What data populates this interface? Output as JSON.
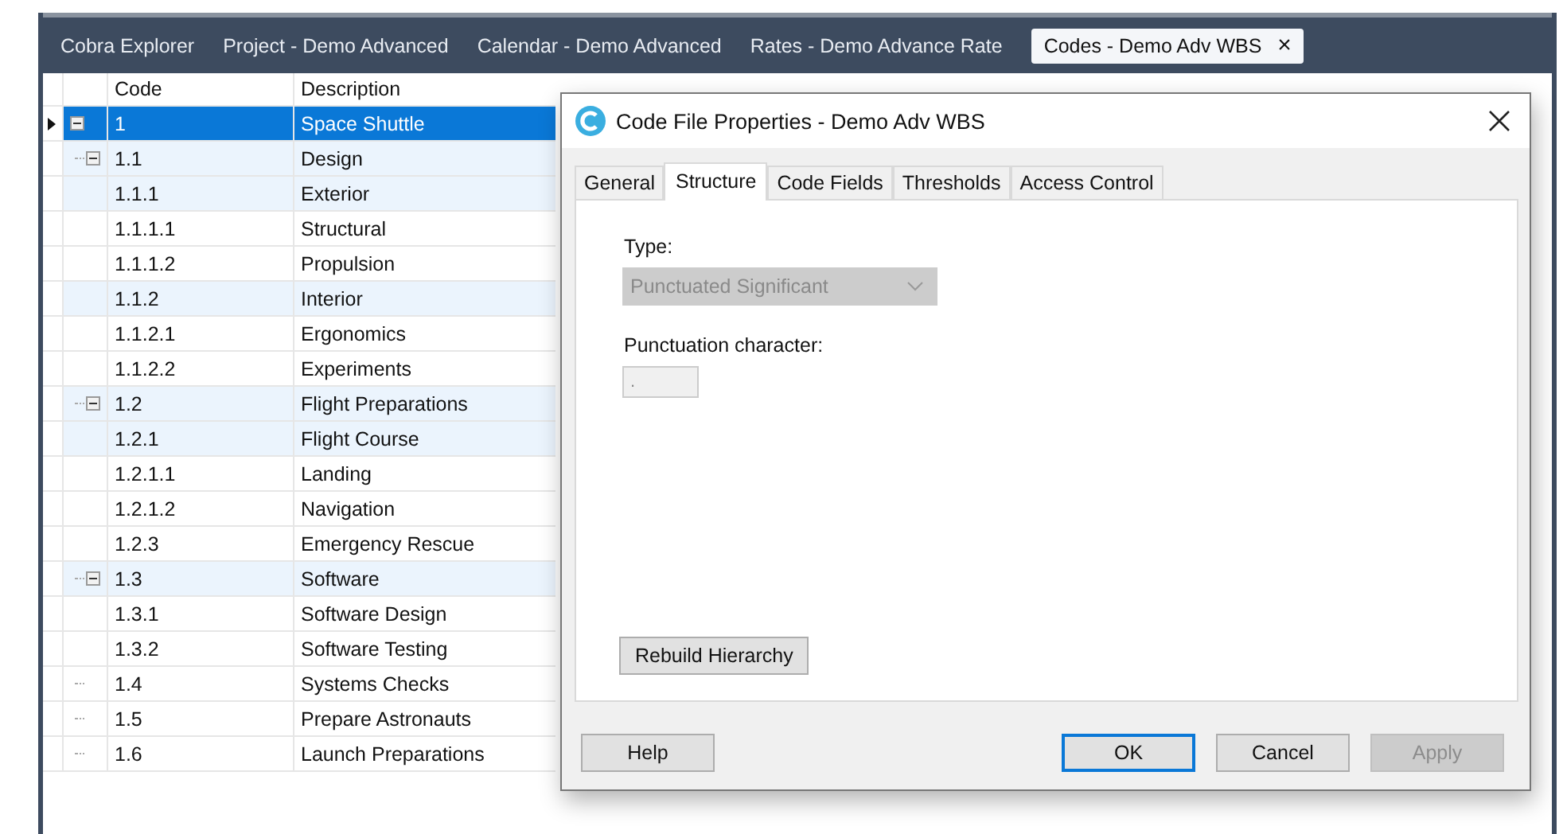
{
  "app_tabs": [
    {
      "label": "Cobra Explorer",
      "selected": false
    },
    {
      "label": "Project - Demo Advanced",
      "selected": false
    },
    {
      "label": "Calendar - Demo Advanced",
      "selected": false
    },
    {
      "label": "Rates - Demo Advance Rate",
      "selected": false
    },
    {
      "label": "Codes - Demo Adv WBS",
      "selected": true,
      "close": "×"
    }
  ],
  "grid": {
    "columns": [
      "Code",
      "Description"
    ],
    "rows": [
      {
        "code": "1",
        "description": "Space Shuttle",
        "selected": true,
        "expanded": true,
        "children": [
          {
            "code": "1.1",
            "description": "Design",
            "selected": false,
            "expanded": true,
            "children": [
              {
                "code": "1.1.1",
                "description": "Exterior",
                "selected": false,
                "children": [
                  {
                    "code": "1.1.1.1",
                    "description": "Structural",
                    "selected": false
                  },
                  {
                    "code": "1.1.1.2",
                    "description": "Propulsion",
                    "selected": false
                  }
                ]
              },
              {
                "code": "1.1.2",
                "description": "Interior",
                "selected": false,
                "children": [
                  {
                    "code": "1.1.2.1",
                    "description": "Ergonomics",
                    "selected": false
                  },
                  {
                    "code": "1.1.2.2",
                    "description": "Experiments",
                    "selected": false
                  }
                ]
              }
            ]
          },
          {
            "code": "1.2",
            "description": "Flight Preparations",
            "selected": false,
            "expanded": true,
            "children": [
              {
                "code": "1.2.1",
                "description": "Flight Course",
                "selected": false,
                "children": [
                  {
                    "code": "1.2.1.1",
                    "description": "Landing",
                    "selected": false
                  },
                  {
                    "code": "1.2.1.2",
                    "description": "Navigation",
                    "selected": false
                  }
                ]
              },
              {
                "code": "1.2.3",
                "description": "Emergency Rescue",
                "selected": false
              }
            ]
          },
          {
            "code": "1.3",
            "description": "Software",
            "selected": false,
            "expanded": true,
            "children": [
              {
                "code": "1.3.1",
                "description": "Software Design",
                "selected": false
              },
              {
                "code": "1.3.2",
                "description": "Software Testing",
                "selected": false
              }
            ]
          },
          {
            "code": "1.4",
            "description": "Systems Checks",
            "selected": false
          },
          {
            "code": "1.5",
            "description": "Prepare Astronauts",
            "selected": false
          },
          {
            "code": "1.6",
            "description": "Launch Preparations",
            "selected": false
          }
        ]
      }
    ]
  },
  "dialog": {
    "title": "Code File Properties - Demo Adv WBS",
    "tabs": [
      {
        "label": "General",
        "selected": false
      },
      {
        "label": "Structure",
        "selected": true
      },
      {
        "label": "Code Fields",
        "selected": false
      },
      {
        "label": "Thresholds",
        "selected": false
      },
      {
        "label": "Access Control",
        "selected": false
      }
    ],
    "type_label": "Type:",
    "type_value": "Punctuated Significant",
    "type_disabled": true,
    "punctuation_label": "Punctuation character:",
    "punctuation_value": ".",
    "rebuild_button": "Rebuild Hierarchy",
    "buttons": [
      {
        "label": "Help",
        "kind": "left",
        "default": false,
        "disabled": false
      },
      {
        "label": "OK",
        "kind": "right",
        "default": true,
        "disabled": false
      },
      {
        "label": "Cancel",
        "kind": "right",
        "default": false,
        "disabled": false
      },
      {
        "label": "Apply",
        "kind": "right",
        "default": false,
        "disabled": true
      }
    ]
  }
}
